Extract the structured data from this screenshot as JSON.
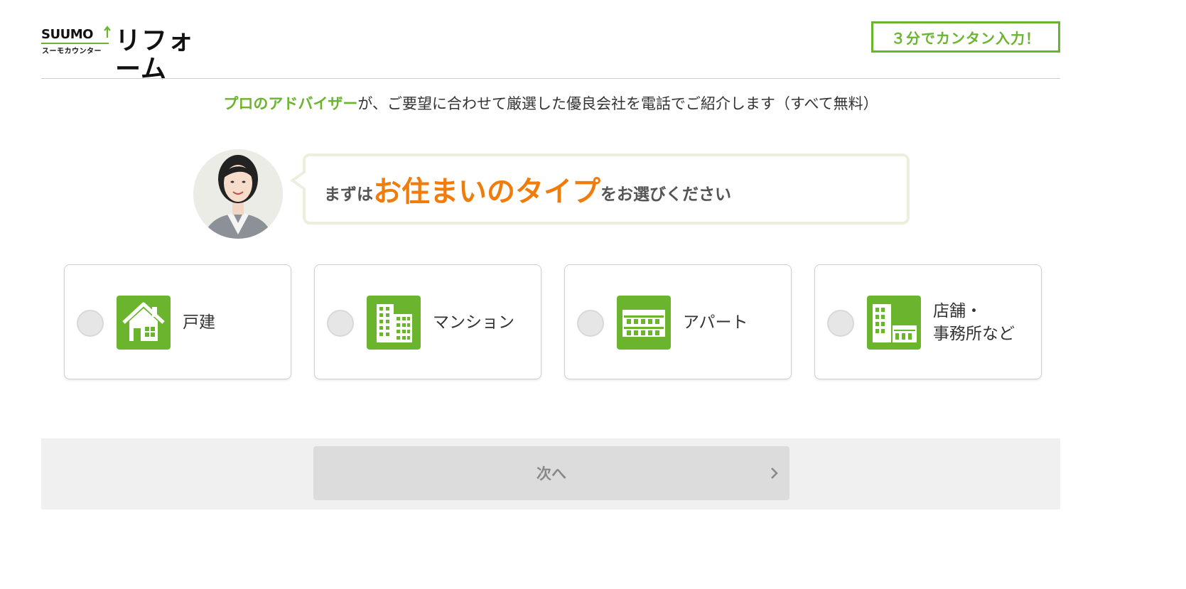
{
  "header": {
    "logo_brand": "SUUMO",
    "logo_sub": "スーモカウンター",
    "logo_product": "リフォーム",
    "cta_badge": "３分でカンタン入力！"
  },
  "intro": {
    "highlight": "プロのアドバイザー",
    "text": "が、ご要望に合わせて厳選した優良会社を電話でご紹介します（すべて無料）"
  },
  "bubble": {
    "prefix": "まずは",
    "emphasis": "お住まいのタイプ",
    "suffix": "をお選びください"
  },
  "options": [
    {
      "label": "戸建",
      "icon": "house-icon"
    },
    {
      "label": "マンション",
      "icon": "apartment-building-icon"
    },
    {
      "label": "アパート",
      "icon": "low-rise-apartment-icon"
    },
    {
      "label": "店舗・\n事務所など",
      "icon": "shop-office-icon"
    }
  ],
  "footer": {
    "next_label": "次へ"
  },
  "colors": {
    "brand_green": "#6ab42e",
    "accent_orange": "#f07c0c",
    "disabled_button": "#dcdcdc"
  }
}
